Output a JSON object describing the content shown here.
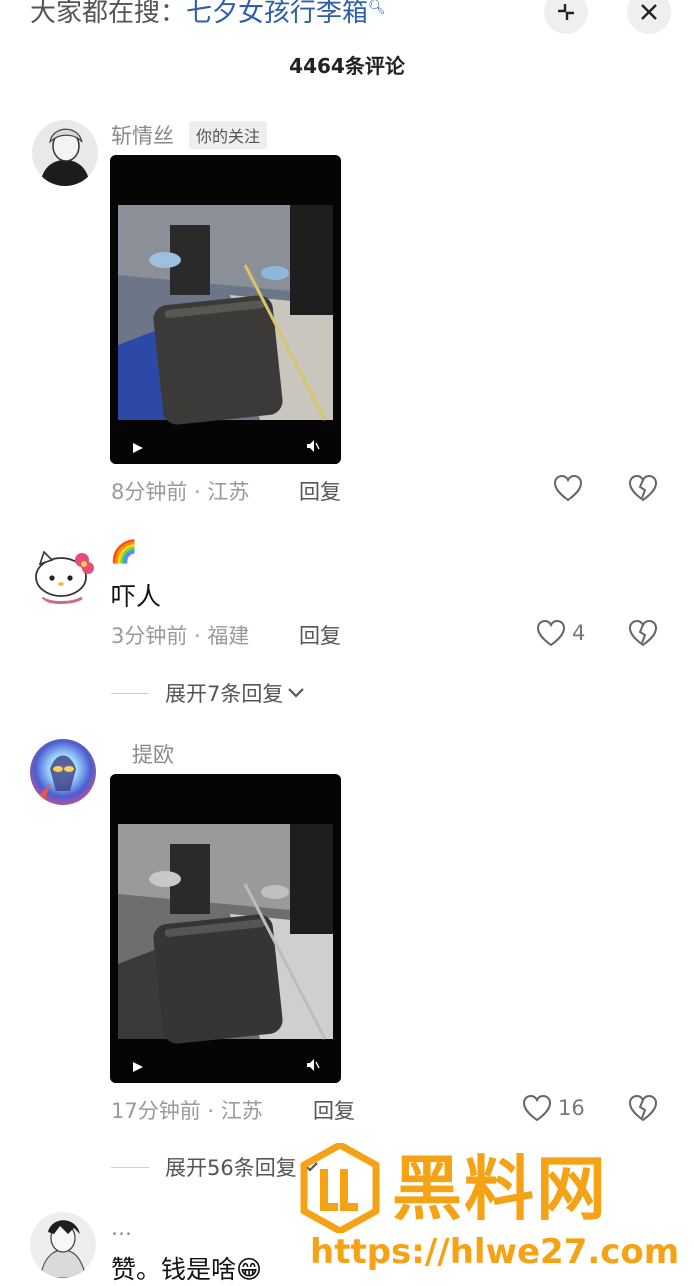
{
  "header": {
    "search_prefix": "大家都在搜：",
    "search_keyword": "七夕女孩行李箱",
    "comment_count": "4464条评论"
  },
  "comments": [
    {
      "username": "斩情丝",
      "tag": "你的关注",
      "time": "8分钟前",
      "location": "江苏",
      "reply_label": "回复",
      "likes": ""
    },
    {
      "username": "🌈",
      "text": "吓人",
      "time": "3分钟前",
      "location": "福建",
      "reply_label": "回复",
      "likes": "4",
      "expand_label": "展开7条回复"
    },
    {
      "username": "提欧",
      "time": "17分钟前",
      "location": "江苏",
      "reply_label": "回复",
      "likes": "16",
      "expand_label": "展开56条回复"
    },
    {
      "username": "…",
      "text": "赞。钱是啥😁"
    }
  ],
  "watermark": {
    "title": "黑料网",
    "url": "https://hlwe27.com"
  },
  "colors": {
    "keyword": "#2b5fa8",
    "watermark": "#f5a214"
  }
}
